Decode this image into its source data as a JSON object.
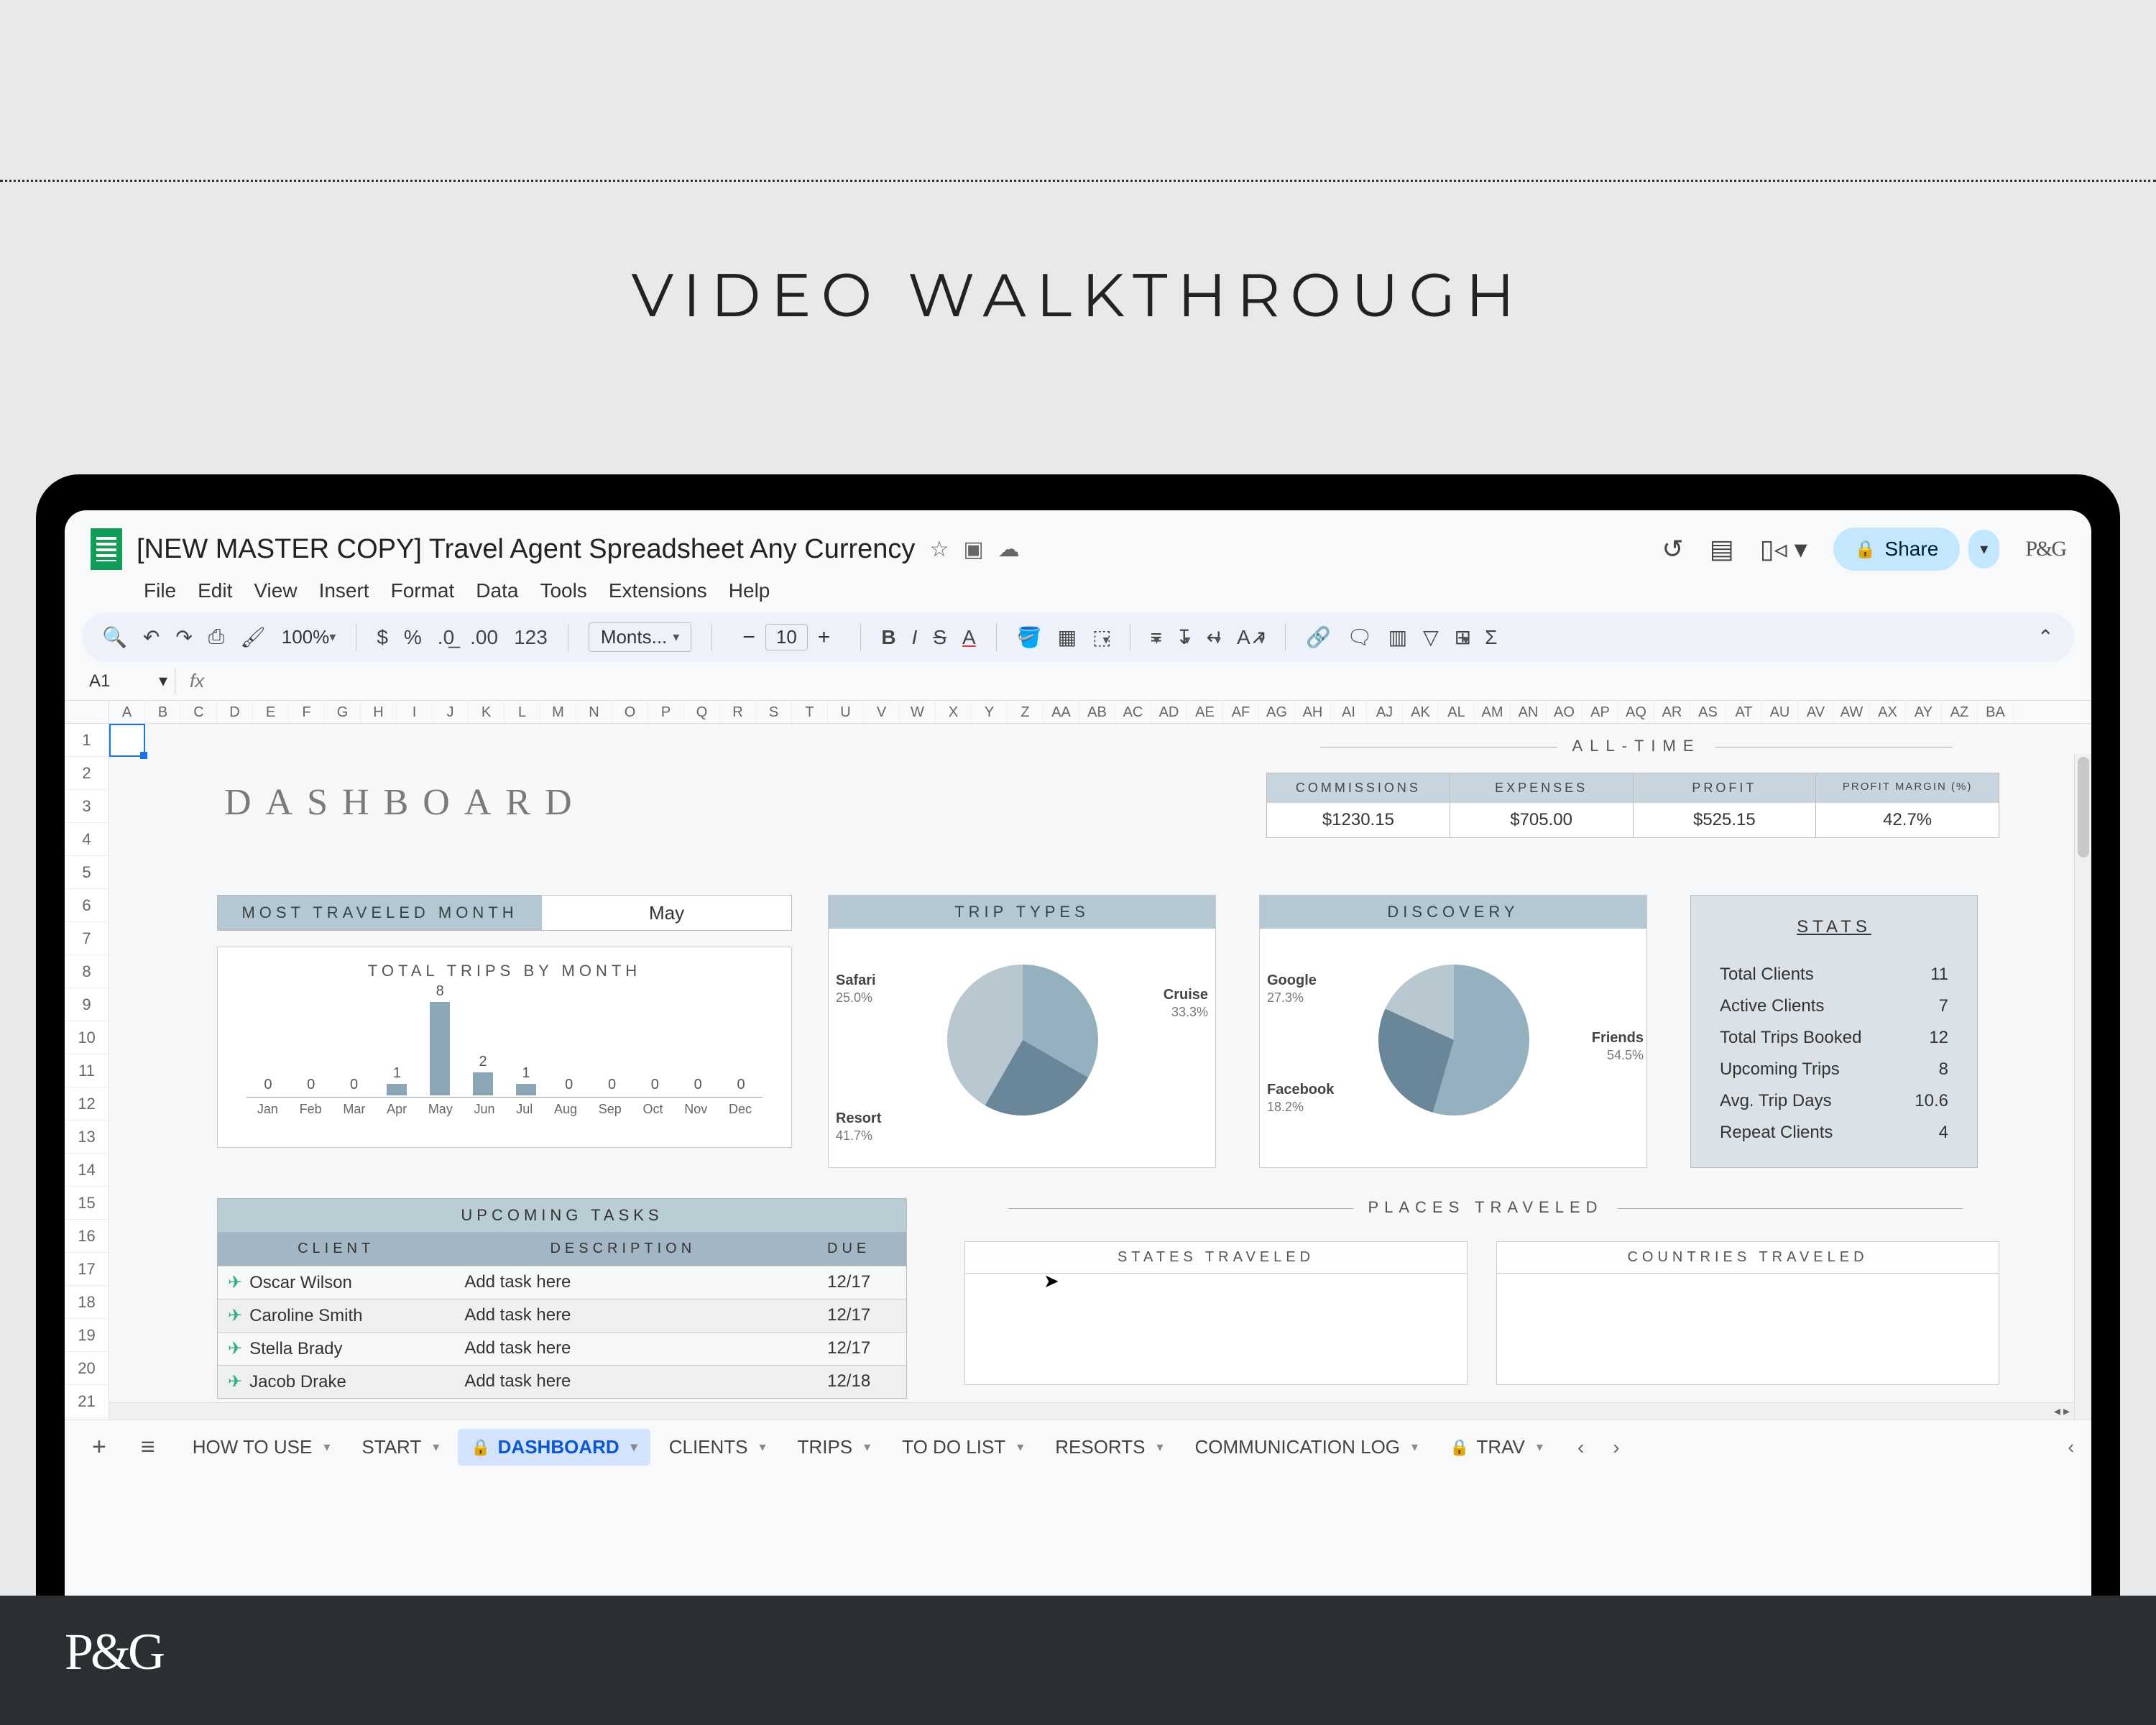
{
  "page_heading": "VIDEO WALKTHROUGH",
  "doc_title": "[NEW MASTER COPY] Travel Agent Spreadsheet Any Currency",
  "share_label": "Share",
  "avatar_label": "P&G",
  "menus": [
    "File",
    "Edit",
    "View",
    "Insert",
    "Format",
    "Data",
    "Tools",
    "Extensions",
    "Help"
  ],
  "toolbar": {
    "zoom": "100%",
    "font": "Monts...",
    "size": "10"
  },
  "namebox": "A1",
  "columns": [
    "A",
    "B",
    "C",
    "D",
    "E",
    "F",
    "G",
    "H",
    "I",
    "J",
    "K",
    "L",
    "M",
    "N",
    "O",
    "P",
    "Q",
    "R",
    "S",
    "T",
    "U",
    "V",
    "W",
    "X",
    "Y",
    "Z",
    "AA",
    "AB",
    "AC",
    "AD",
    "AE",
    "AF",
    "AG",
    "AH",
    "AI",
    "AJ",
    "AK",
    "AL",
    "AM",
    "AN",
    "AO",
    "AP",
    "AQ",
    "AR",
    "AS",
    "AT",
    "AU",
    "AV",
    "AW",
    "AX",
    "AY",
    "AZ",
    "BA"
  ],
  "rows": [
    "1",
    "2",
    "3",
    "4",
    "5",
    "6",
    "7",
    "8",
    "9",
    "10",
    "11",
    "12",
    "13",
    "14",
    "15",
    "16",
    "17",
    "18",
    "19",
    "20",
    "21"
  ],
  "dash_title": "DASHBOARD",
  "alltime": {
    "label": "ALL-TIME",
    "headers": [
      "COMMISSIONS",
      "EXPENSES",
      "PROFIT",
      "PROFIT MARGIN (%)"
    ],
    "values": [
      "$1230.15",
      "$705.00",
      "$525.15",
      "42.7%"
    ]
  },
  "most_month": {
    "label": "MOST TRAVELED MONTH",
    "value": "May"
  },
  "trip_types_title": "TRIP TYPES",
  "discovery_title": "DISCOVERY",
  "stats": {
    "title": "STATS",
    "rows": [
      {
        "label": "Total Clients",
        "val": "11"
      },
      {
        "label": "Active Clients",
        "val": "7"
      },
      {
        "label": "Total Trips Booked",
        "val": "12"
      },
      {
        "label": "Upcoming Trips",
        "val": "8"
      },
      {
        "label": "Avg. Trip Days",
        "val": "10.6"
      },
      {
        "label": "Repeat Clients",
        "val": "4"
      }
    ]
  },
  "tasks": {
    "title": "UPCOMING TASKS",
    "cols": [
      "CLIENT",
      "DESCRIPTION",
      "DUE"
    ],
    "rows": [
      {
        "client": "Oscar Wilson",
        "desc": "Add task here",
        "due": "12/17"
      },
      {
        "client": "Caroline Smith",
        "desc": "Add task here",
        "due": "12/17"
      },
      {
        "client": "Stella Brady",
        "desc": "Add task here",
        "due": "12/17"
      },
      {
        "client": "Jacob Drake",
        "desc": "Add task here",
        "due": "12/18"
      }
    ]
  },
  "places_label": "PLACES TRAVELED",
  "states_title": "STATES TRAVELED",
  "countries_title": "COUNTRIES TRAVELED",
  "sheet_tabs": [
    {
      "label": "HOW TO USE",
      "active": false,
      "locked": false
    },
    {
      "label": "START",
      "active": false,
      "locked": false
    },
    {
      "label": "DASHBOARD",
      "active": true,
      "locked": true
    },
    {
      "label": "CLIENTS",
      "active": false,
      "locked": false
    },
    {
      "label": "TRIPS",
      "active": false,
      "locked": false
    },
    {
      "label": "TO DO LIST",
      "active": false,
      "locked": false
    },
    {
      "label": "RESORTS",
      "active": false,
      "locked": false
    },
    {
      "label": "COMMUNICATION LOG",
      "active": false,
      "locked": false
    },
    {
      "label": "TRAV",
      "active": false,
      "locked": true
    }
  ],
  "footer_brand": "P&G",
  "chart_data": [
    {
      "type": "bar",
      "title": "TOTAL TRIPS BY MONTH",
      "categories": [
        "Jan",
        "Feb",
        "Mar",
        "Apr",
        "May",
        "Jun",
        "Jul",
        "Aug",
        "Sep",
        "Oct",
        "Nov",
        "Dec"
      ],
      "values": [
        0,
        0,
        0,
        1,
        8,
        2,
        1,
        0,
        0,
        0,
        0,
        0
      ],
      "ylim": [
        0,
        8
      ]
    },
    {
      "type": "pie",
      "title": "TRIP TYPES",
      "series": [
        {
          "name": "Cruise",
          "value": 33.3
        },
        {
          "name": "Safari",
          "value": 25.0
        },
        {
          "name": "Resort",
          "value": 41.7
        }
      ]
    },
    {
      "type": "pie",
      "title": "DISCOVERY",
      "series": [
        {
          "name": "Friends",
          "value": 54.5
        },
        {
          "name": "Google",
          "value": 27.3
        },
        {
          "name": "Facebook",
          "value": 18.2
        }
      ]
    }
  ]
}
